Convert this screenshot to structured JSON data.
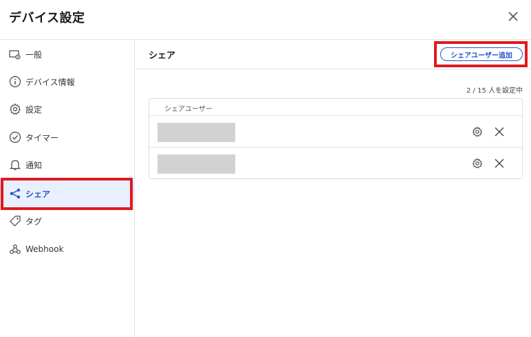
{
  "dialog": {
    "title": "デバイス設定"
  },
  "sidebar": {
    "items": [
      {
        "label": "一般",
        "icon": "device-gear-icon"
      },
      {
        "label": "デバイス情報",
        "icon": "info-icon"
      },
      {
        "label": "設定",
        "icon": "gear-icon"
      },
      {
        "label": "タイマー",
        "icon": "timer-icon"
      },
      {
        "label": "通知",
        "icon": "bell-icon"
      },
      {
        "label": "シェア",
        "icon": "share-icon",
        "active": true
      },
      {
        "label": "タグ",
        "icon": "tag-icon"
      },
      {
        "label": "Webhook",
        "icon": "webhook-icon"
      }
    ]
  },
  "main": {
    "title": "シェア",
    "add_button": "シェアユーザー追加",
    "count_text": "2 / 15 人を設定中",
    "table": {
      "header": "シェアユーザー",
      "rows": 2
    }
  },
  "colors": {
    "accent": "#2553c6",
    "active_bg": "#e8efff",
    "highlight": "#e0191e",
    "redacted": "#d2d2d2"
  }
}
